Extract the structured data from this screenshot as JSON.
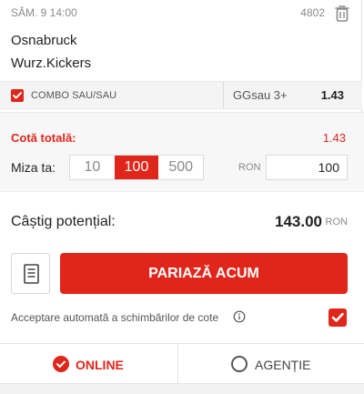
{
  "bet": {
    "date": "SÂM. 9   14:00",
    "bet_id": "4802",
    "home_team": "Osnabruck",
    "away_team": "Wurz.Kickers",
    "market": "COMBO SAU/SAU",
    "selection": "GGsau 3+",
    "odds": "1.43"
  },
  "stake": {
    "total_odds_label": "Cotă totală:",
    "total_odds_value": "1.43",
    "stake_label": "Miza ta:",
    "quick_stakes": [
      "10",
      "100",
      "500"
    ],
    "selected_quick_stake": "100",
    "currency": "RON",
    "stake_value": "100"
  },
  "summary": {
    "potential_win_label": "Câștig potențial:",
    "potential_win_value": "143.00",
    "currency": "RON",
    "place_bet_label": "PARIAZĂ ACUM",
    "auto_accept_label": "Acceptare automată a schimbărilor de cote",
    "auto_accept_checked": true
  },
  "tabs": {
    "online_label": "ONLINE",
    "agency_label": "AGENȚIE",
    "selected": "online"
  },
  "colors": {
    "accent": "#e0261b",
    "muted_text": "#8a8a8a"
  },
  "icons": {
    "delete": "trash-icon",
    "checkbox": "check-icon",
    "betslip": "document-icon",
    "info": "info-icon"
  }
}
